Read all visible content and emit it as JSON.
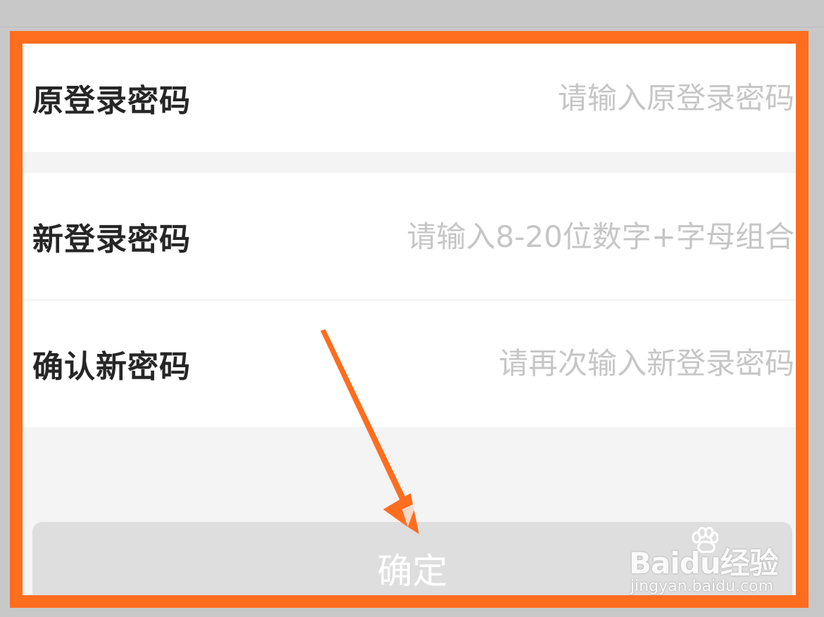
{
  "form": {
    "old_password_label": "原登录密码",
    "old_password_placeholder": "请输入原登录密码",
    "new_password_label": "新登录密码",
    "new_password_placeholder": "请输入8-20位数字+字母组合",
    "confirm_password_label": "确认新密码",
    "confirm_password_placeholder": "请再次输入新登录密码",
    "submit_label": "确定"
  },
  "annotation": {
    "highlight_color": "#ff6d1f",
    "arrow_color": "#ff6d1f"
  },
  "watermark": {
    "main_text_prefix": "Bai",
    "main_text_suffix": "du",
    "main_text_extra": "经验",
    "subtext": "jingyan.baidu.com"
  },
  "icons": {
    "paw": "paw-icon"
  }
}
